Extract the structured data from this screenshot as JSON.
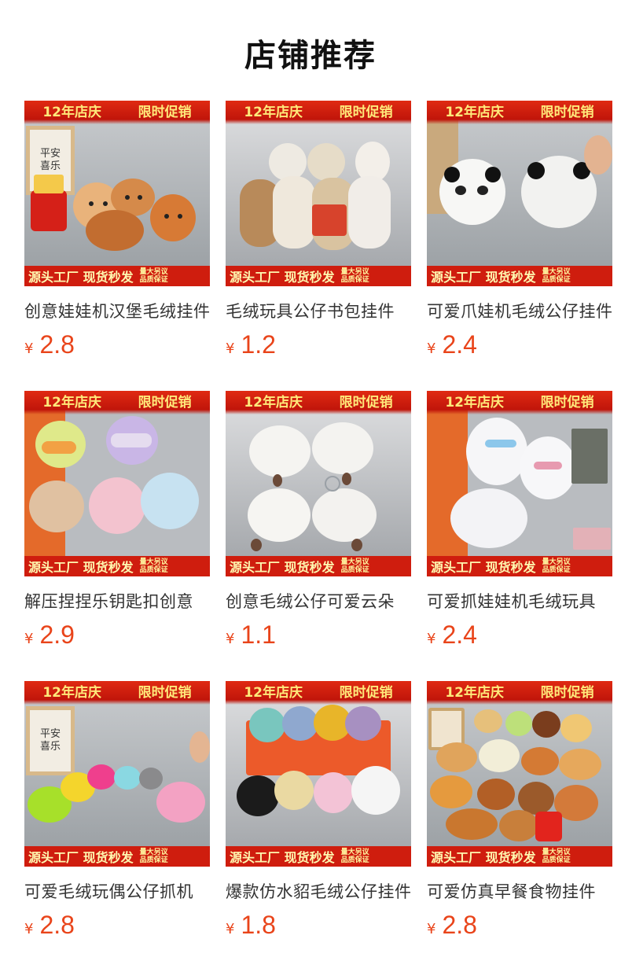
{
  "page": {
    "title": "店铺推荐"
  },
  "banner": {
    "top_left": "12年店庆",
    "top_right": "限时促销",
    "bottom_main": "源头工厂 现货秒发",
    "bottom_small_1": "量大另议",
    "bottom_small_2": "品质保证"
  },
  "products": [
    {
      "name": "创意娃娃机汉堡毛绒挂件",
      "currency": "¥",
      "price": "2.8",
      "frame_text": [
        "平安",
        "喜乐"
      ]
    },
    {
      "name": "毛绒玩具公仔书包挂件",
      "currency": "¥",
      "price": "1.2"
    },
    {
      "name": "可爱爪娃机毛绒公仔挂件",
      "currency": "¥",
      "price": "2.4"
    },
    {
      "name": "解压捏捏乐钥匙扣创意",
      "currency": "¥",
      "price": "2.9"
    },
    {
      "name": "创意毛绒公仔可爱云朵",
      "currency": "¥",
      "price": "1.1"
    },
    {
      "name": "可爱抓娃娃机毛绒玩具",
      "currency": "¥",
      "price": "2.4"
    },
    {
      "name": "可爱毛绒玩偶公仔抓机",
      "currency": "¥",
      "price": "2.8",
      "frame_text": [
        "平安",
        "喜乐"
      ]
    },
    {
      "name": "爆款仿水貂毛绒公仔挂件",
      "currency": "¥",
      "price": "1.8"
    },
    {
      "name": "可爱仿真早餐食物挂件",
      "currency": "¥",
      "price": "2.8"
    }
  ]
}
